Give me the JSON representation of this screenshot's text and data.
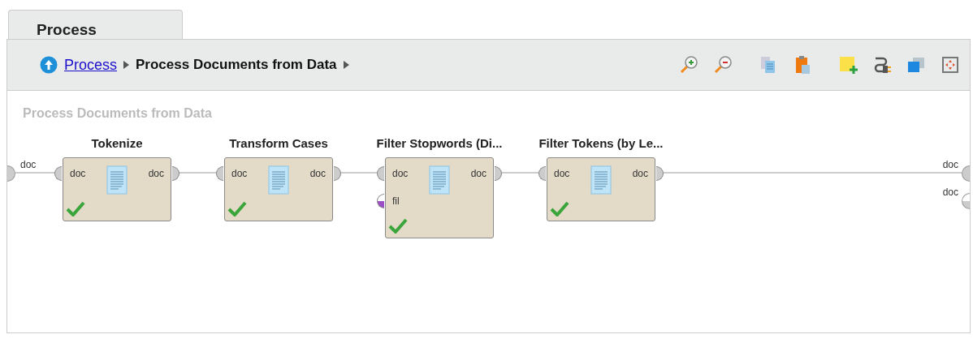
{
  "tabs": [
    {
      "label": "Process",
      "selected": true
    }
  ],
  "breadcrumb": {
    "link": "Process",
    "current": "Process Documents from Data"
  },
  "canvas": {
    "title": "Process Documents from Data",
    "inputs": [
      {
        "label": "doc",
        "connected": true
      }
    ],
    "outputs": [
      {
        "label": "doc",
        "connected": true
      },
      {
        "label": "doc",
        "connected": false
      }
    ],
    "operators": [
      {
        "name": "Tokenize",
        "valid": true,
        "inputs": [
          {
            "label": "doc",
            "connected": true
          }
        ],
        "outputs": [
          {
            "label": "doc",
            "connected": true
          }
        ]
      },
      {
        "name": "Transform Cases",
        "valid": true,
        "inputs": [
          {
            "label": "doc",
            "connected": true
          }
        ],
        "outputs": [
          {
            "label": "doc",
            "connected": true
          }
        ]
      },
      {
        "name": "Filter Stopwords (Di...",
        "valid": true,
        "inputs": [
          {
            "label": "doc",
            "connected": true
          },
          {
            "label": "fil",
            "connected": false,
            "color": "#9b4fc4"
          }
        ],
        "outputs": [
          {
            "label": "doc",
            "connected": true
          }
        ]
      },
      {
        "name": "Filter Tokens (by Le...",
        "valid": true,
        "inputs": [
          {
            "label": "doc",
            "connected": true
          }
        ],
        "outputs": [
          {
            "label": "doc",
            "connected": true
          }
        ]
      }
    ]
  }
}
